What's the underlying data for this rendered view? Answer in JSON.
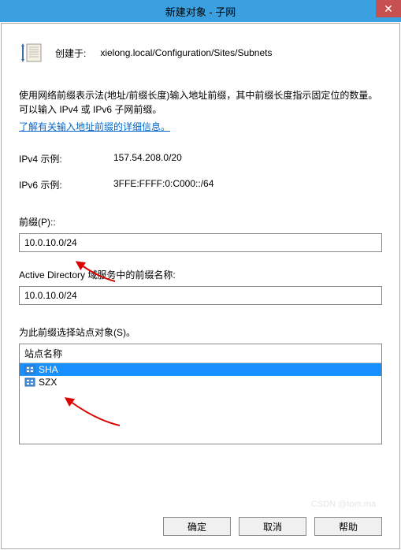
{
  "titlebar": {
    "title": "新建对象 - 子网"
  },
  "header": {
    "created_in_label": "创建于:",
    "path": "xielong.local/Configuration/Sites/Subnets"
  },
  "description": {
    "line1": "使用网络前缀表示法(地址/前缀长度)输入地址前缀，其中前缀长度指示固定位的数量。可以输入 IPv4 或 IPv6 子网前缀。",
    "link": "了解有关输入地址前缀的详细信息。"
  },
  "examples": {
    "ipv4_label": "IPv4 示例:",
    "ipv4_value": "157.54.208.0/20",
    "ipv6_label": "IPv6 示例:",
    "ipv6_value": "3FFE:FFFF:0:C000::/64"
  },
  "prefix": {
    "label": "前缀(P)::",
    "value": "10.0.10.0/24"
  },
  "ad_name": {
    "label": "Active Directory 域服务中的前缀名称:",
    "value": "10.0.10.0/24"
  },
  "sites": {
    "label": "为此前缀选择站点对象(S)。",
    "column_header": "站点名称",
    "items": [
      {
        "name": "SHA",
        "selected": true
      },
      {
        "name": "SZX",
        "selected": false
      }
    ]
  },
  "buttons": {
    "ok": "确定",
    "cancel": "取消",
    "help": "帮助"
  }
}
